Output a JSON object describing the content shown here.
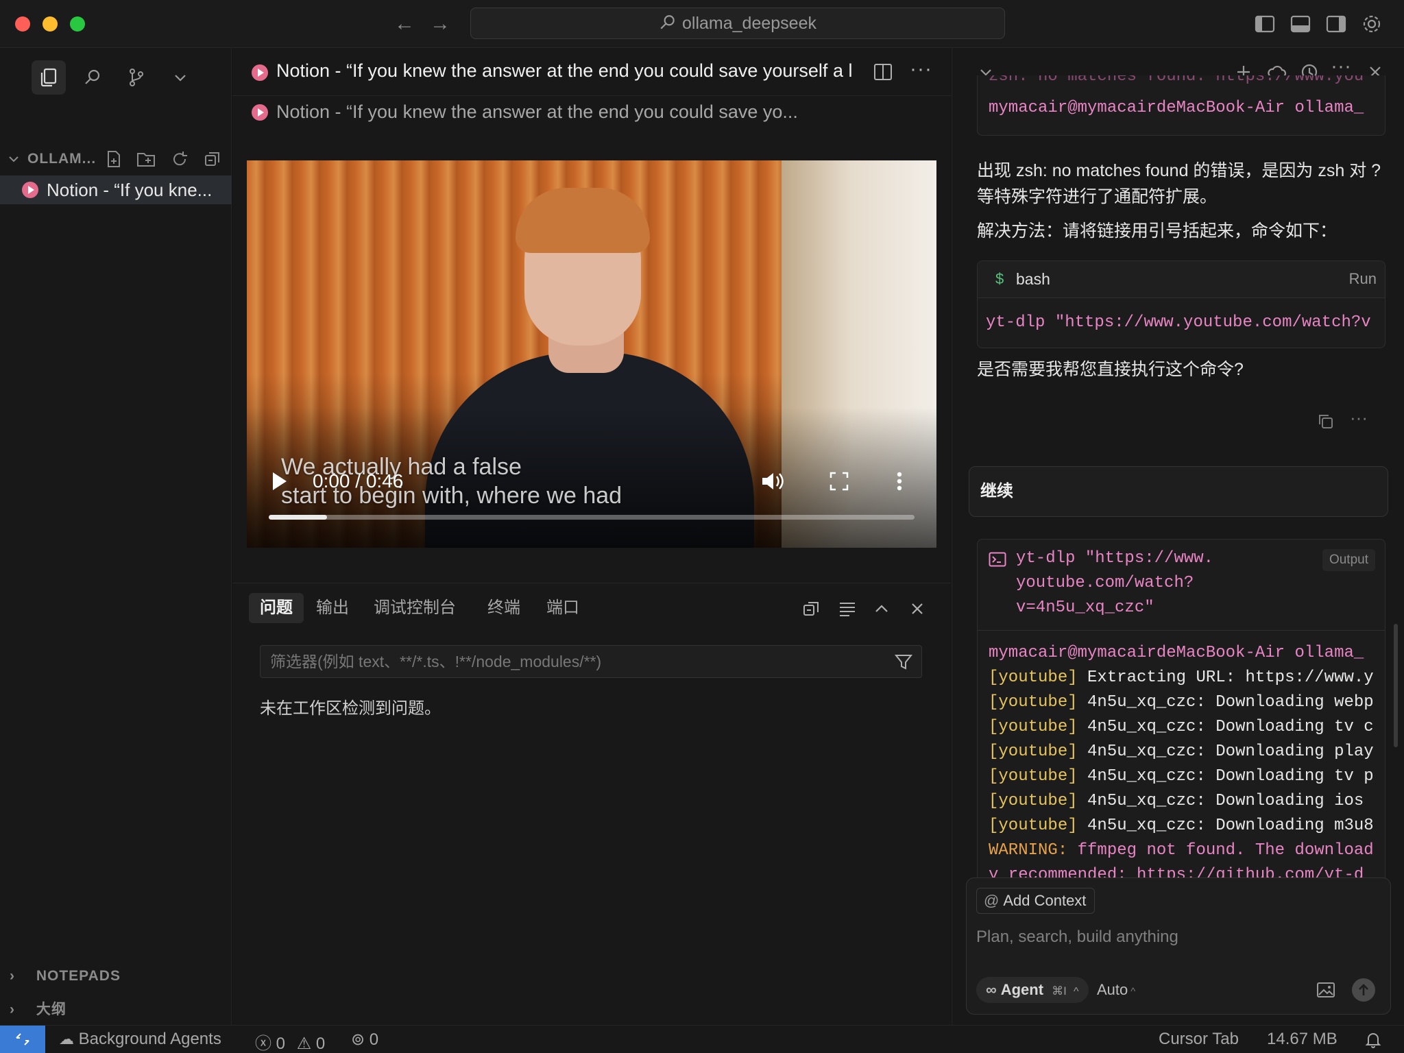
{
  "window": {
    "search_label": "ollama_deepseek",
    "traffic_colors": [
      "#ff5f57",
      "#febc2e",
      "#28c840"
    ]
  },
  "sidebar": {
    "workspace_label": "OLLAM...",
    "open_file": "Notion - “If you kne...",
    "sections": [
      "NOTEPADS",
      "大纲"
    ]
  },
  "editor": {
    "tab_title": "Notion - “If you knew the answer at the end you could save yourself a l",
    "breadcrumb": "Notion - “If you knew the answer at the end you could save yo...",
    "video": {
      "caption_line1": "We actually had a false",
      "caption_line2": "start to begin with, where we had",
      "time": "0:00 / 0:46",
      "progress_fraction": 0.09
    }
  },
  "panel": {
    "tabs": [
      "问题",
      "输出",
      "调试控制台",
      "终端",
      "端口"
    ],
    "active_tab": 0,
    "filter_placeholder": "筛选器(例如 text、**/*.ts、!**/node_modules/**)",
    "message": "未在工作区检测到问题。"
  },
  "chat": {
    "top_card_line1": "zsh: no matches found: https://www.you",
    "top_card_line2": "mymacair@mymacairdeMacBook-Air ollama_",
    "para1": "出现 zsh: no matches found 的错误，是因为 zsh 对 ? 等特殊字符进行了通配符扩展。",
    "para2": "解决方法：请将链接用引号括起来，命令如下：",
    "code_lang": "bash",
    "code_run": "Run",
    "code_line": "yt-dlp \"https://www.youtube.com/watch?v",
    "para3": "是否需要我帮您直接执行这个命令?",
    "continue_text": "继续",
    "terminal": {
      "command_lines": [
        "yt-dlp \"https://www.",
        "youtube.com/watch?",
        "v=4n5u_xq_czc\""
      ],
      "output_badge": "Output",
      "prompt_line": "mymacair@mymacairdeMacBook-Air ollama_",
      "lines": [
        {
          "tag": "[youtube]",
          "text": " Extracting URL: https://www.y"
        },
        {
          "tag": "[youtube]",
          "text": " 4n5u_xq_czc: Downloading webp"
        },
        {
          "tag": "[youtube]",
          "text": " 4n5u_xq_czc: Downloading tv c"
        },
        {
          "tag": "[youtube]",
          "text": " 4n5u_xq_czc: Downloading play"
        },
        {
          "tag": "[youtube]",
          "text": " 4n5u_xq_czc: Downloading tv p"
        },
        {
          "tag": "[youtube]",
          "text": " 4n5u_xq_czc: Downloading ios"
        },
        {
          "tag": "[youtube]",
          "text": " 4n5u_xq_czc: Downloading m3u8"
        }
      ],
      "warning_label": "WARNING:",
      "warning_text": " ffmpeg not found. The download",
      "last_line": "y recommended: https://github.com/yt-d"
    },
    "composer": {
      "add_context": "Add Context",
      "placeholder": "Plan, search, build anything",
      "agent_label": "Agent",
      "agent_shortcut": "⌘I",
      "model_label": "Auto"
    }
  },
  "statusbar": {
    "background_agents": "Background Agents",
    "errors": "0",
    "warnings": "0",
    "ports": "0",
    "cursor_tab": "Cursor Tab",
    "memory": "14.67 MB"
  },
  "colors": {
    "notion_icon": "#e46b8c",
    "accent_remote": "#3a7bd5",
    "code_pink": "#e985c4",
    "youtube_tag": "#e6c45b"
  }
}
